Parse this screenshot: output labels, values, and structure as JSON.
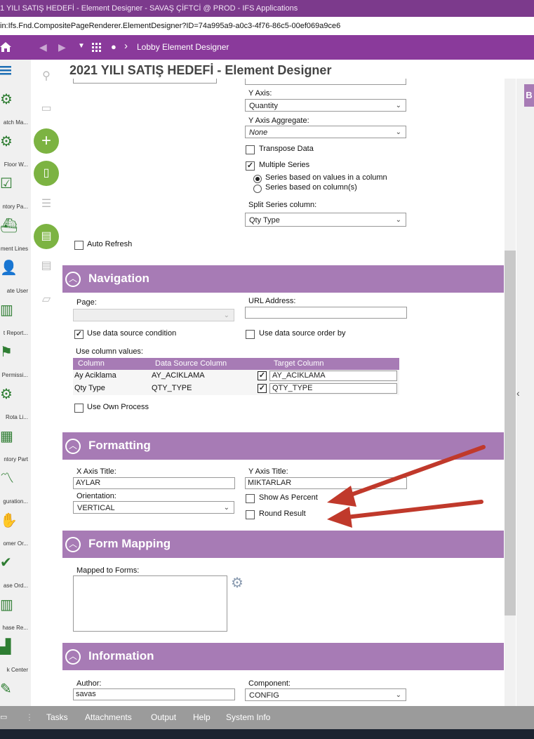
{
  "window": {
    "title": "1 YILI SATIŞ HEDEFİ - Element Designer - SAVAŞ ÇİFTCİ @ PROD - IFS Applications",
    "url": "in:Ifs.Fnd.CompositePageRenderer.ElementDesigner?ID=74a995a9-a0c3-4f76-86c5-00ef069a9ce6"
  },
  "navbar": {
    "breadcrumb": "Lobby Element Designer"
  },
  "page": {
    "title": "2021 YILI SATIŞ HEDEFİ - Element Designer"
  },
  "sidebar": {
    "items": [
      {
        "label": "atch Ma...",
        "icon": "gear-icon"
      },
      {
        "label": "Floor W...",
        "icon": "gears-icon"
      },
      {
        "label": "ntory Pa...",
        "icon": "checklist-icon"
      },
      {
        "label": "ment Lines",
        "icon": "ship-icon"
      },
      {
        "label": "ate User",
        "icon": "user-icon"
      },
      {
        "label": "t Report...",
        "icon": "bar-chart-icon"
      },
      {
        "label": "Permissi...",
        "icon": "flag-icon"
      },
      {
        "label": "Rota Li...",
        "icon": "gears-icon"
      },
      {
        "label": "ntory Part",
        "icon": "table-icon"
      },
      {
        "label": "guration...",
        "icon": "line-chart-icon"
      },
      {
        "label": "omer Or...",
        "icon": "handshake-icon"
      },
      {
        "label": "ase Ord...",
        "icon": "check-icon"
      },
      {
        "label": "hase Re...",
        "icon": "bar-chart-icon"
      },
      {
        "label": "k Center",
        "icon": "factory-icon"
      },
      {
        "label": "",
        "icon": "wrench-icon"
      }
    ]
  },
  "chart_settings": {
    "y_axis_label": "Y Axis:",
    "y_axis_value": "Quantity",
    "y_axis_aggregate_label": "Y Axis Aggregate:",
    "y_axis_aggregate_value": "None",
    "transpose_label": "Transpose Data",
    "transpose_checked": false,
    "multiple_series_label": "Multiple Series",
    "multiple_series_checked": true,
    "series_values_label": "Series based on values in a column",
    "series_columns_label": "Series based on column(s)",
    "split_series_label": "Split Series column:",
    "split_series_value": "Qty Type",
    "auto_refresh_label": "Auto Refresh"
  },
  "navigation": {
    "title": "Navigation",
    "page_label": "Page:",
    "page_value": "",
    "url_label": "URL Address:",
    "url_value": "",
    "use_ds_condition_label": "Use data source condition",
    "use_ds_condition_checked": true,
    "use_ds_order_label": "Use data source order by",
    "use_ds_order_checked": false,
    "column_values_label": "Use column values:",
    "columns": [
      "Column",
      "Data Source Column",
      "Target Column"
    ],
    "rows": [
      {
        "column": "Ay Aciklama",
        "ds_column": "AY_ACIKLAMA",
        "checked": true,
        "target": "AY_ACIKLAMA"
      },
      {
        "column": "Qty Type",
        "ds_column": "QTY_TYPE",
        "checked": true,
        "target": "QTY_TYPE"
      }
    ],
    "use_own_process_label": "Use Own Process"
  },
  "formatting": {
    "title": "Formatting",
    "x_axis_title_label": "X Axis Title:",
    "x_axis_title_value": "AYLAR",
    "y_axis_title_label": "Y Axis Title:",
    "y_axis_title_value": "MIKTARLAR",
    "orientation_label": "Orientation:",
    "orientation_value": "VERTICAL",
    "show_percent_label": "Show As Percent",
    "round_result_label": "Round Result"
  },
  "form_mapping": {
    "title": "Form Mapping",
    "mapped_label": "Mapped to Forms:"
  },
  "information": {
    "title": "Information",
    "author_label": "Author:",
    "author_value": "savas",
    "component_label": "Component:",
    "component_value": "CONFIG"
  },
  "bottombar": {
    "items": [
      "Tasks",
      "Attachments",
      "Output",
      "Help",
      "System Info"
    ]
  },
  "right_panel": {
    "label": "B"
  },
  "colors": {
    "accent": "#8a3a9b",
    "section": "#a77bb5",
    "green": "#7cb342",
    "arrow": "#c0392b"
  }
}
